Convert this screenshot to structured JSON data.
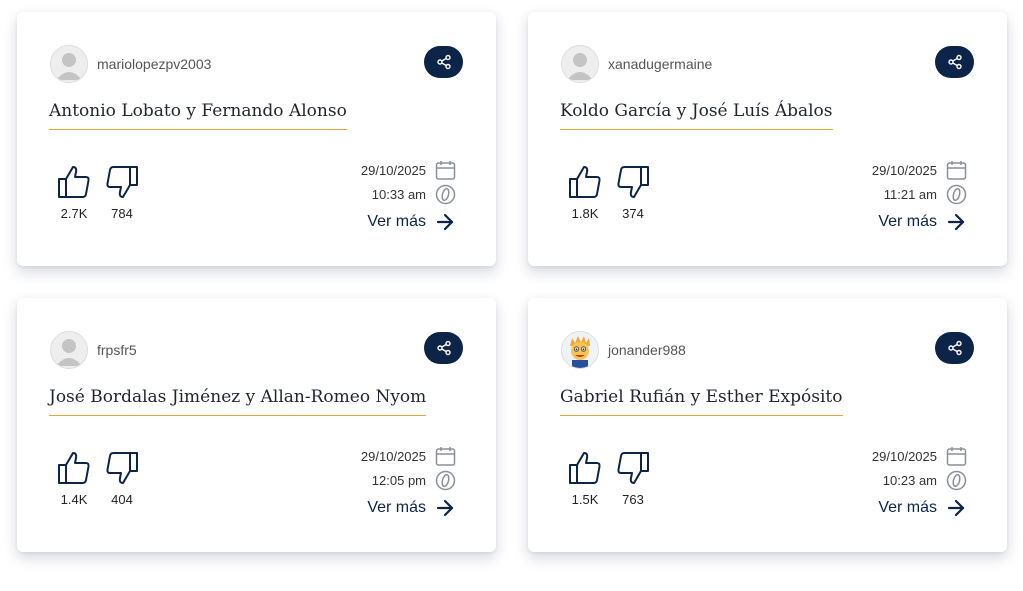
{
  "cards": [
    {
      "username": "mariolopezpv2003",
      "avatar": "default-user-icon",
      "title": "Antonio Lobato y Fernando Alonso",
      "likes": "2.7K",
      "dislikes": "784",
      "date": "29/10/2025",
      "time": "10:33 am",
      "more_label": "Ver más"
    },
    {
      "username": "xanadugermaine",
      "avatar": "default-user-icon",
      "title": "Koldo García y José Luís Ábalos",
      "likes": "1.8K",
      "dislikes": "374",
      "date": "29/10/2025",
      "time": "11:21 am",
      "more_label": "Ver más"
    },
    {
      "username": "frpsfr5",
      "avatar": "default-user-icon",
      "title": "José Bordalas Jiménez y Allan-Romeo Nyom",
      "likes": "1.4K",
      "dislikes": "404",
      "date": "29/10/2025",
      "time": "12:05 pm",
      "more_label": "Ver más"
    },
    {
      "username": "jonander988",
      "avatar": "cartoon-character-avatar",
      "title": "Gabriel Rufián y Esther Expósito",
      "likes": "1.5K",
      "dislikes": "763",
      "date": "29/10/2025",
      "time": "10:23 am",
      "more_label": "Ver más"
    }
  ],
  "colors": {
    "navy": "#0b2447",
    "accent_underline": "#e8a33d",
    "icon_gray": "#8a8f99"
  }
}
